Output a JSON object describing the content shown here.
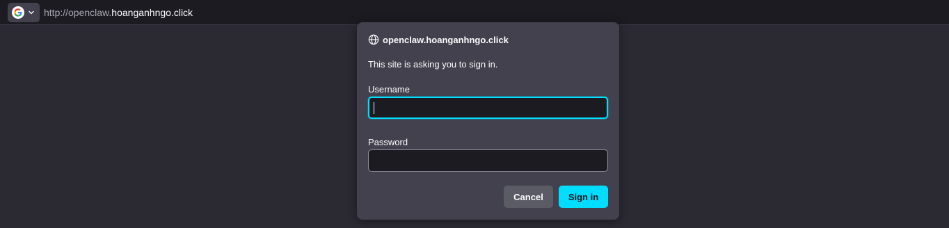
{
  "urlbar": {
    "scheme_text": "http://openclaw.",
    "host_text": "hoanganhngo.click",
    "identity_icon": "google-g-icon",
    "dropdown_icon": "chevron-down-icon"
  },
  "dialog": {
    "host": "openclaw.hoanganhngo.click",
    "host_icon": "globe-icon",
    "message": "This site is asking you to sign in.",
    "username_label": "Username",
    "username_value": "",
    "password_label": "Password",
    "password_value": "",
    "cancel_label": "Cancel",
    "signin_label": "Sign in"
  },
  "colors": {
    "background": "#2b2a33",
    "toolbar": "#1c1b22",
    "dialog": "#42414d",
    "accent": "#00ddff",
    "cancel_button": "#5b5b66"
  }
}
